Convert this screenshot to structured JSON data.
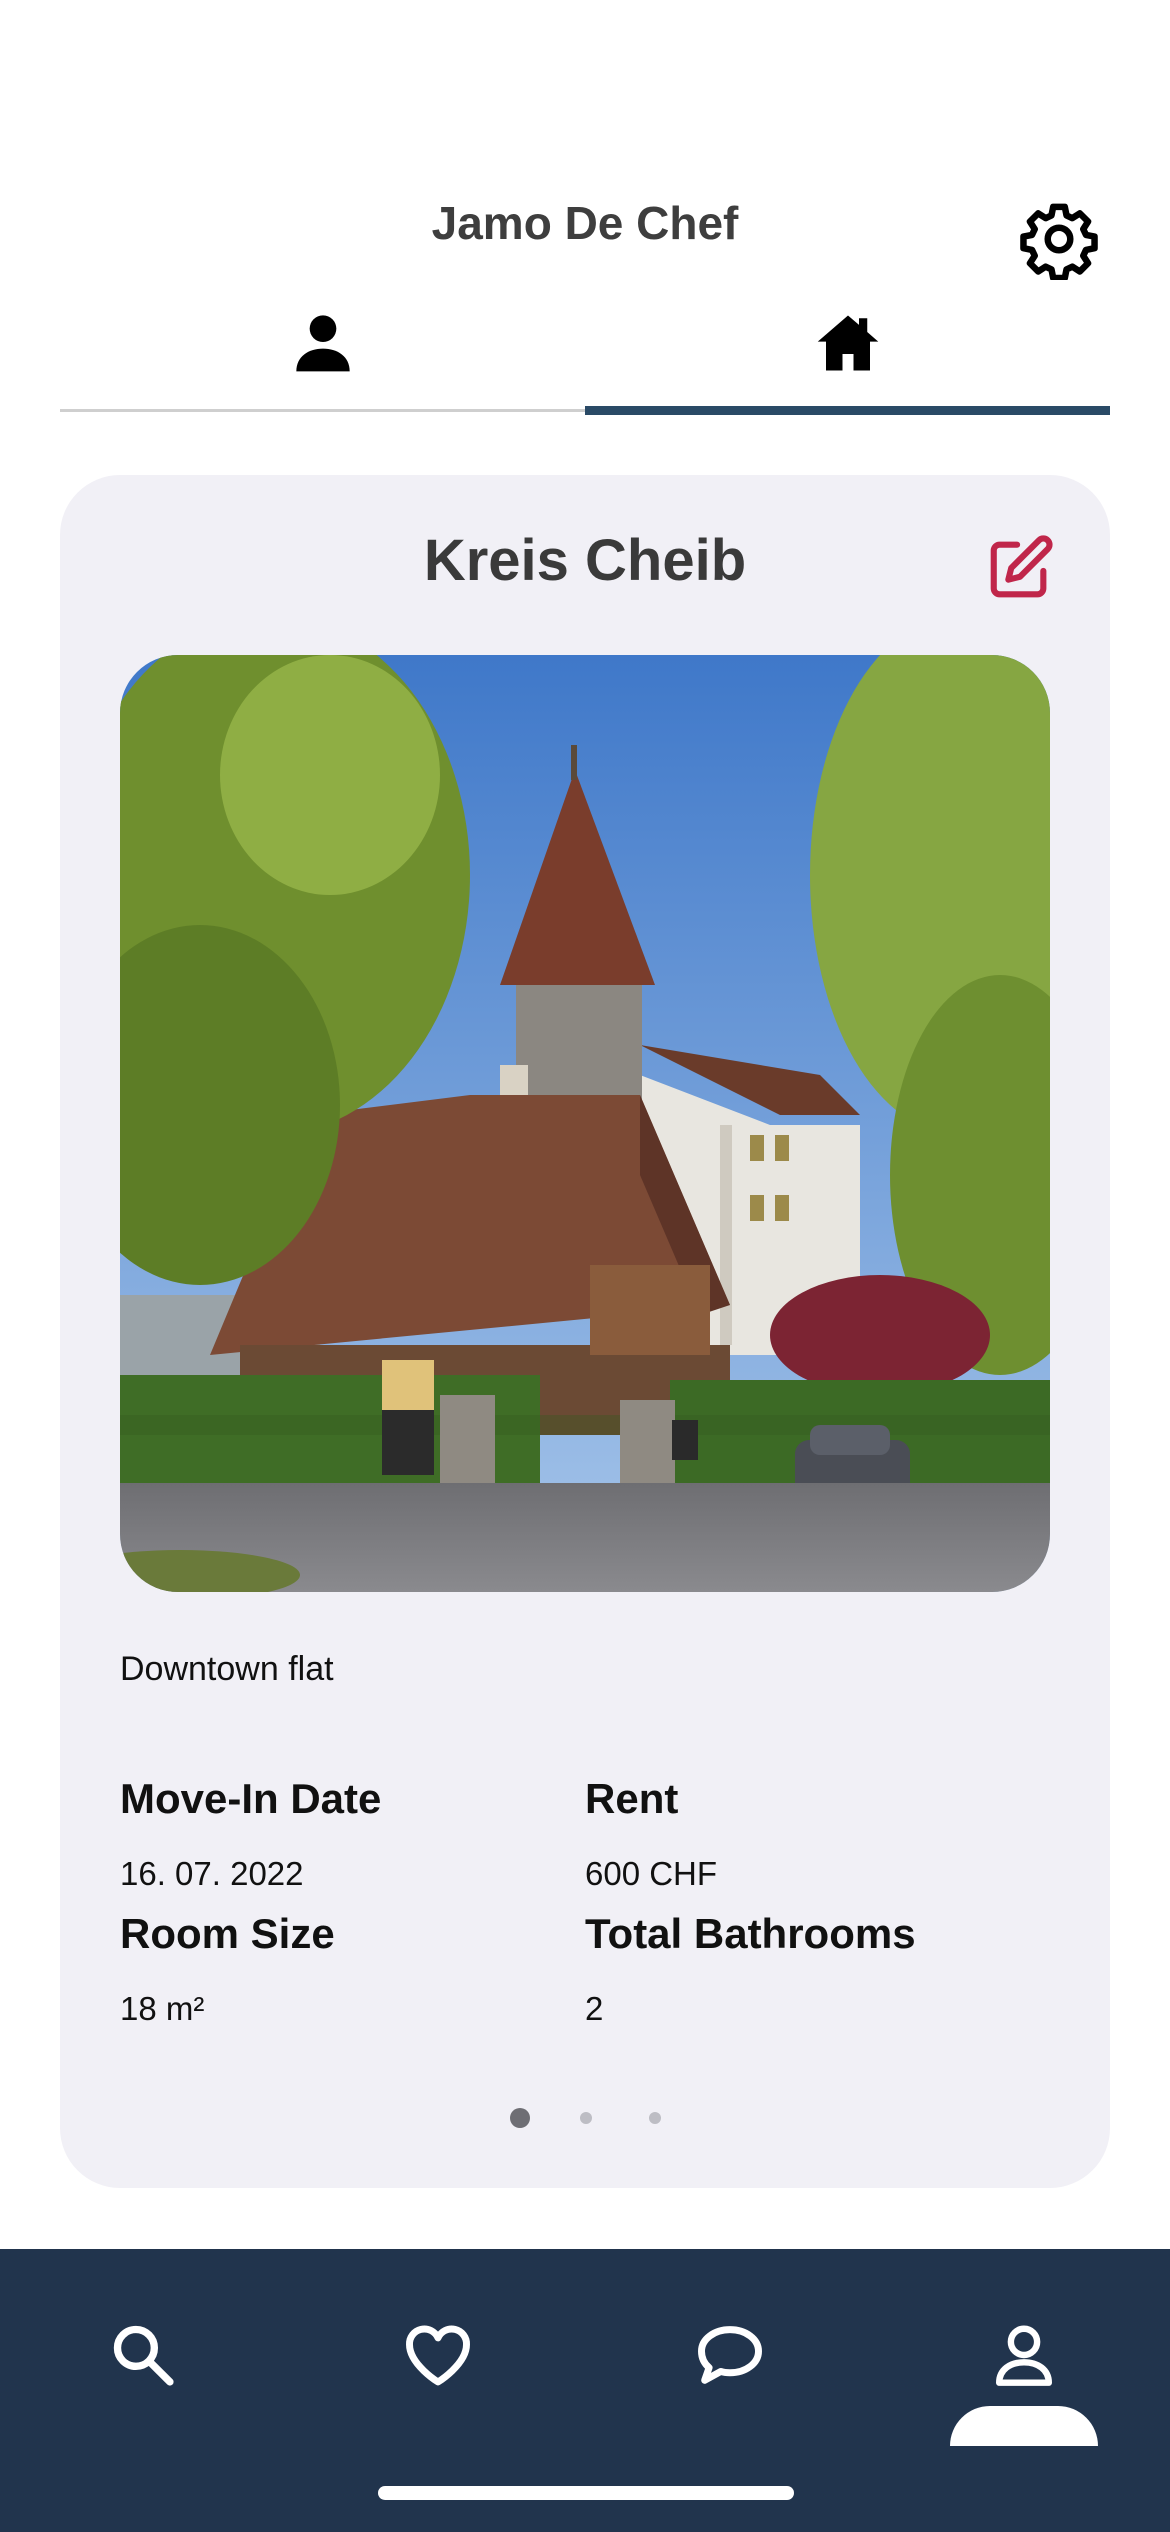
{
  "header": {
    "title": "Jamo De Chef",
    "settings_icon": "gear-icon"
  },
  "tabs": [
    {
      "icon": "person-icon",
      "active": false
    },
    {
      "icon": "home-icon",
      "active": true
    }
  ],
  "colors": {
    "accent": "#2a4a66",
    "edit": "#c0264a",
    "nav_background": "#21344d",
    "card_background": "#f1f0f6"
  },
  "listing": {
    "title": "Kreis Cheib",
    "edit_icon": "edit-icon",
    "photo": "house-photo",
    "description": "Downtown flat",
    "details": {
      "move_in_label": "Move-In Date",
      "move_in_value": "16. 07. 2022",
      "rent_label": "Rent",
      "rent_value": "600 CHF",
      "room_size_label": "Room Size",
      "room_size_value": "18 m²",
      "bathrooms_label": "Total Bathrooms",
      "bathrooms_value": "2"
    },
    "pagination": {
      "count": 3,
      "active_index": 0
    }
  },
  "bottom_nav": [
    {
      "icon": "search-icon",
      "active": false
    },
    {
      "icon": "heart-icon",
      "active": false
    },
    {
      "icon": "chat-icon",
      "active": false
    },
    {
      "icon": "profile-icon",
      "active": true
    }
  ]
}
